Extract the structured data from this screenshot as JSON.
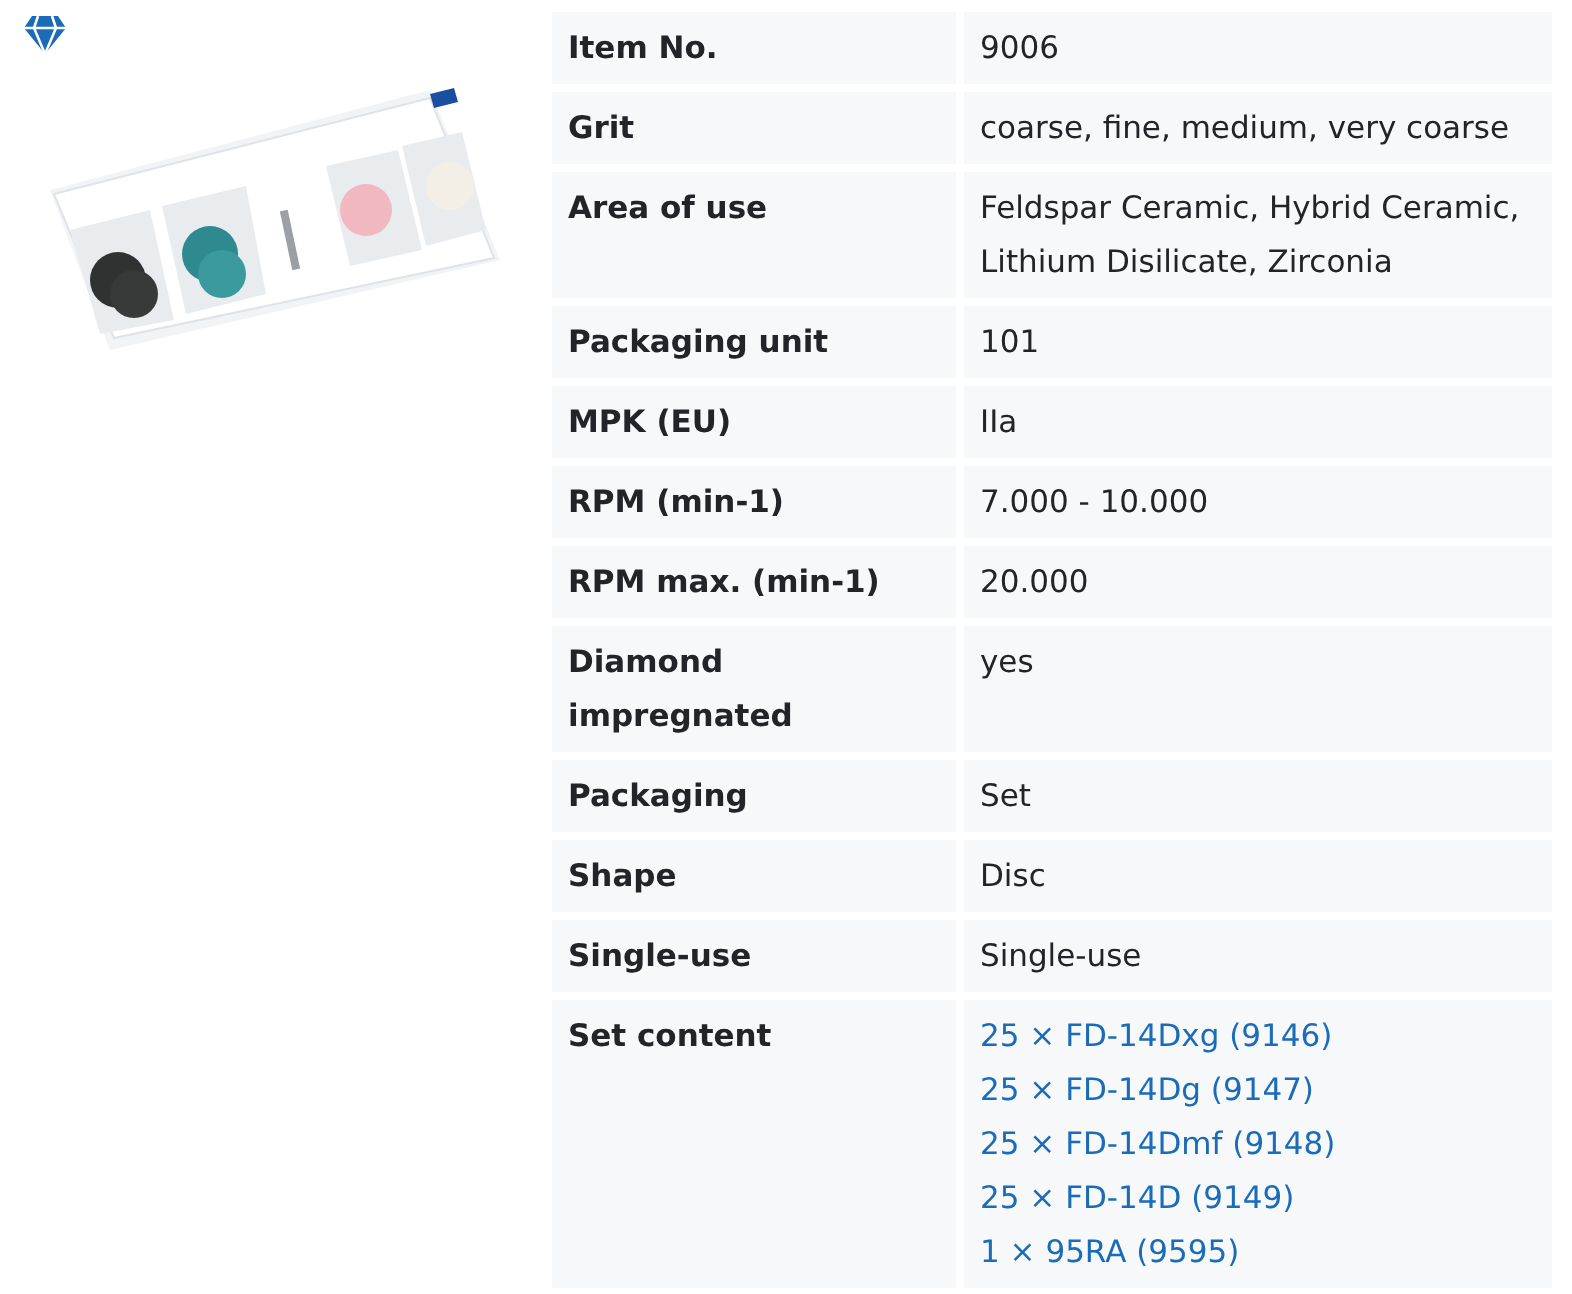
{
  "specs": [
    {
      "label": "Item No.",
      "kind": "text",
      "values": [
        "9006"
      ]
    },
    {
      "label": "Grit",
      "kind": "text",
      "values": [
        "coarse, fine, medium, very coarse"
      ]
    },
    {
      "label": "Area of use",
      "kind": "text",
      "values": [
        "Feldspar Ceramic, Hybrid Ceramic, Lithium Disilicate, Zirconia"
      ]
    },
    {
      "label": "Packaging unit",
      "kind": "text",
      "values": [
        "101"
      ]
    },
    {
      "label": "MPK (EU)",
      "kind": "text",
      "values": [
        "IIa"
      ]
    },
    {
      "label": "RPM (min-1)",
      "kind": "text",
      "values": [
        "7.000 - 10.000"
      ]
    },
    {
      "label": "RPM max. (min-1)",
      "kind": "text",
      "values": [
        "20.000"
      ]
    },
    {
      "label": "Diamond impregnated",
      "kind": "text",
      "values": [
        "yes"
      ]
    },
    {
      "label": "Packaging",
      "kind": "text",
      "values": [
        "Set"
      ]
    },
    {
      "label": "Shape",
      "kind": "text",
      "values": [
        "Disc"
      ]
    },
    {
      "label": "Single-use",
      "kind": "text",
      "values": [
        "Single-use"
      ]
    },
    {
      "label": "Set content",
      "kind": "links",
      "values": [
        "25 × FD-14Dxg (9146)",
        "25 × FD-14Dg (9147)",
        "25 × FD-14Dmf (9148)",
        "25 × FD-14D (9149)",
        "1 × 95RA (9595)"
      ]
    }
  ]
}
